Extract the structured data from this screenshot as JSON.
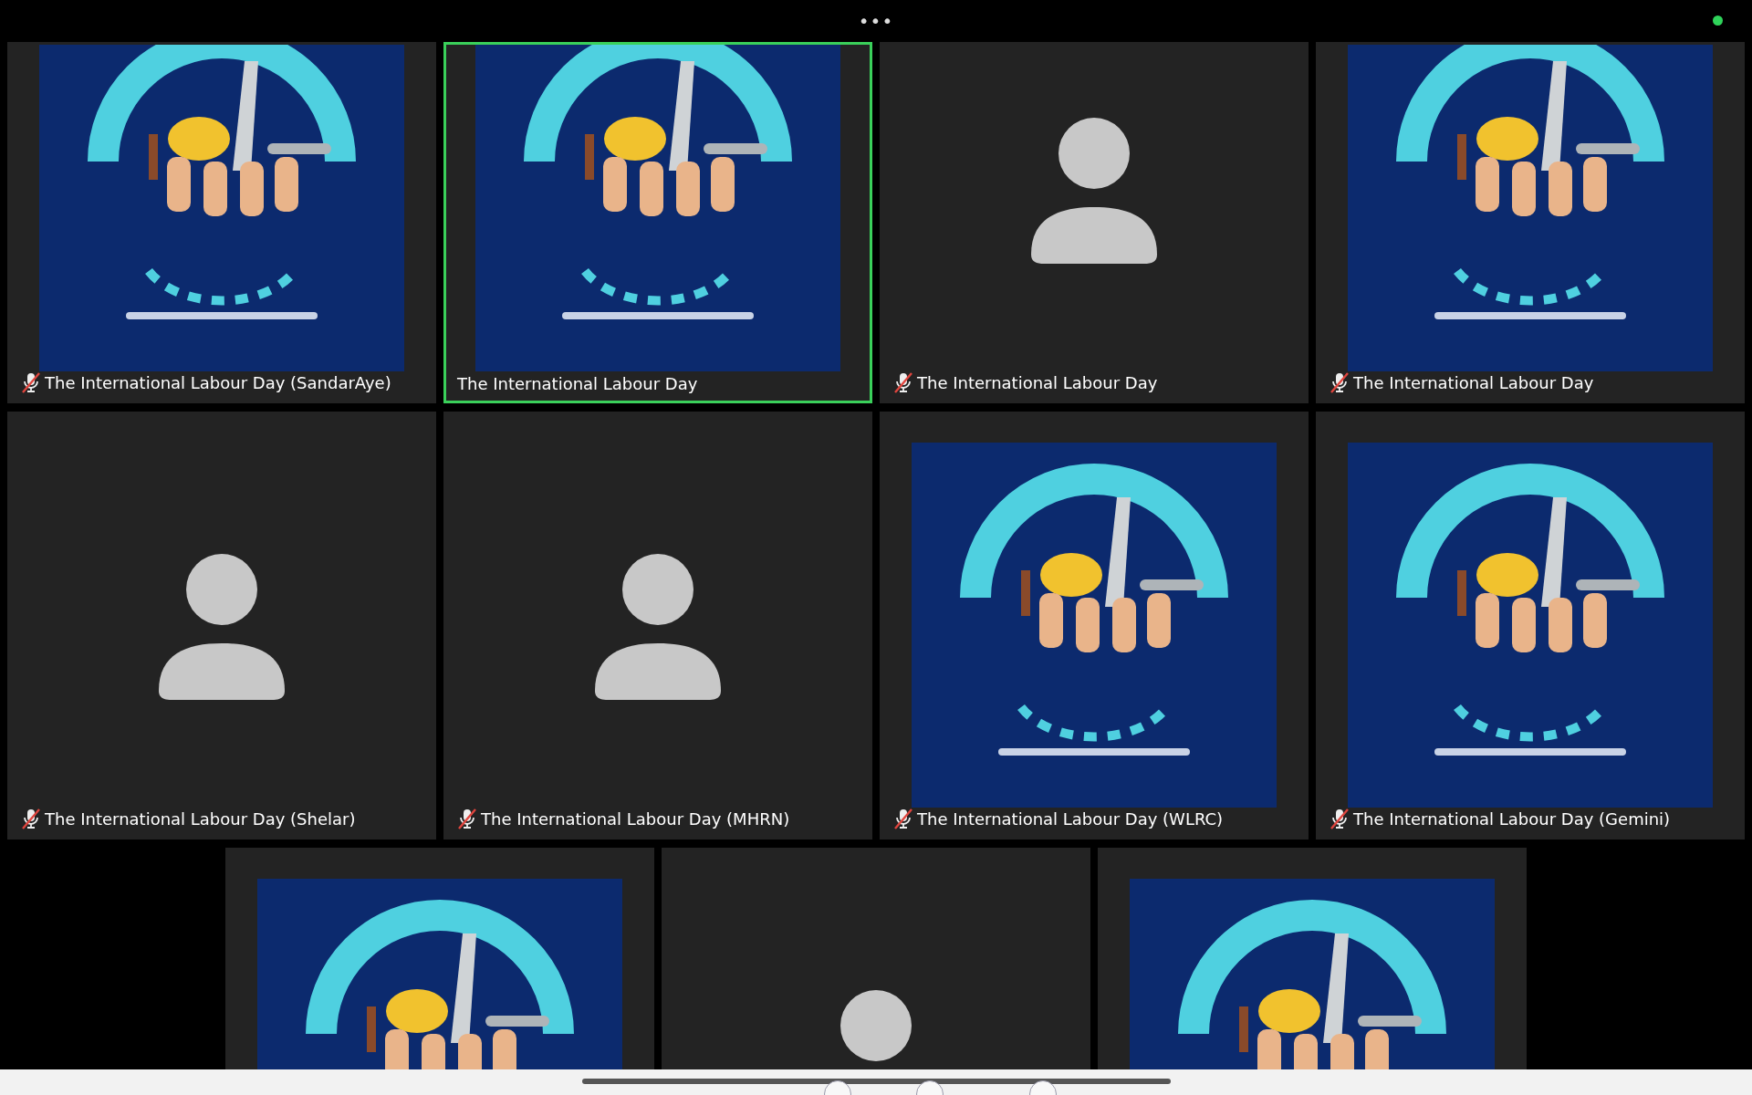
{
  "top_bar": {
    "more_button": "•••",
    "connected": true
  },
  "rows": [
    {
      "tiles": [
        {
          "kind": "picture",
          "name": "The International Labour Day (SandarAye)",
          "muted": true,
          "active": false
        },
        {
          "kind": "picture",
          "name": "The International Labour Day",
          "muted": false,
          "active": true
        },
        {
          "kind": "silhouette",
          "name": "The International Labour Day",
          "muted": true,
          "active": false
        },
        {
          "kind": "picture",
          "name": "The International Labour Day",
          "muted": true,
          "active": false
        }
      ]
    },
    {
      "tiles": [
        {
          "kind": "silhouette",
          "name": "The International Labour Day (Shelar)",
          "muted": true,
          "active": false
        },
        {
          "kind": "silhouette",
          "name": "The International Labour Day (MHRN)",
          "muted": true,
          "active": false
        },
        {
          "kind": "picture",
          "name": "The International Labour Day (WLRC)",
          "muted": true,
          "active": false
        },
        {
          "kind": "picture",
          "name": "The International Labour Day (Gemini)",
          "muted": true,
          "active": false
        }
      ]
    },
    {
      "tiles": [
        {
          "kind": "picture",
          "active": false
        },
        {
          "kind": "silhouette",
          "active": false
        },
        {
          "kind": "picture",
          "active": false
        }
      ]
    }
  ]
}
